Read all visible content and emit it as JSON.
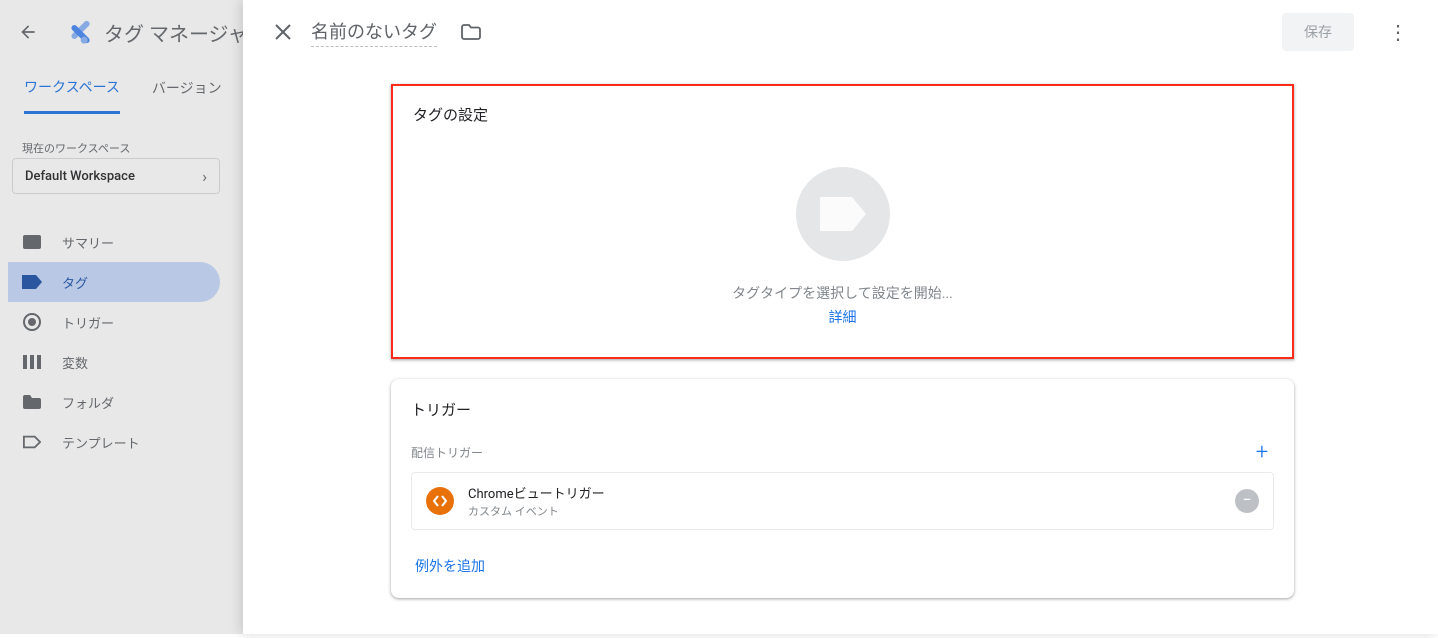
{
  "app": {
    "title": "タグ マネージャー"
  },
  "bg_tabs": [
    "ワークスペース",
    "バージョン"
  ],
  "workspace": {
    "label": "現在のワークスペース",
    "name": "Default Workspace"
  },
  "sidebar": {
    "items": [
      {
        "label": "サマリー"
      },
      {
        "label": "タグ"
      },
      {
        "label": "トリガー"
      },
      {
        "label": "変数"
      },
      {
        "label": "フォルダ"
      },
      {
        "label": "テンプレート"
      }
    ]
  },
  "modal": {
    "title": "名前のないタグ",
    "save_label": "保存",
    "tag_config": {
      "title": "タグの設定",
      "hint": "タグタイプを選択して設定を開始...",
      "detail": "詳細"
    },
    "trigger": {
      "title": "トリガー",
      "sub_label": "配信トリガー",
      "item": {
        "name": "Chromeビュートリガー",
        "type": "カスタム イベント"
      },
      "exception": "例外を追加"
    }
  }
}
